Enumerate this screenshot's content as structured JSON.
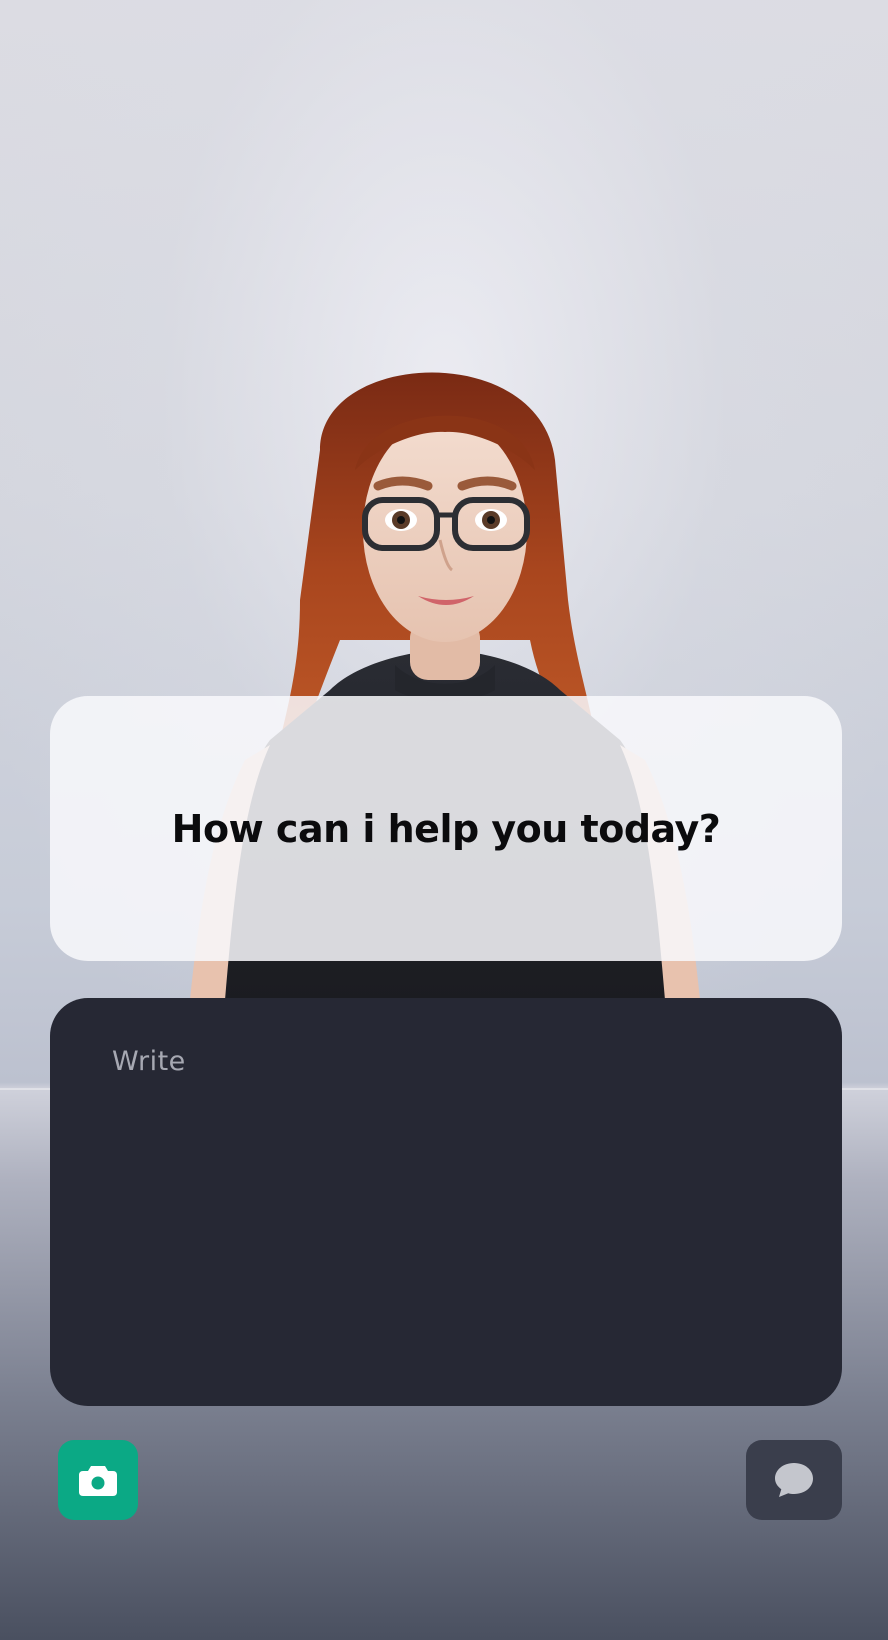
{
  "assistant": {
    "greeting": "How can i help you today?"
  },
  "composer": {
    "placeholder": "Write"
  },
  "controls": {
    "camera_icon": "camera-icon",
    "chat_icon": "chat-bubble-icon"
  },
  "colors": {
    "camera_button": "#0ba985",
    "composer_background": "#262834",
    "chat_button": "#3a3e4c"
  }
}
